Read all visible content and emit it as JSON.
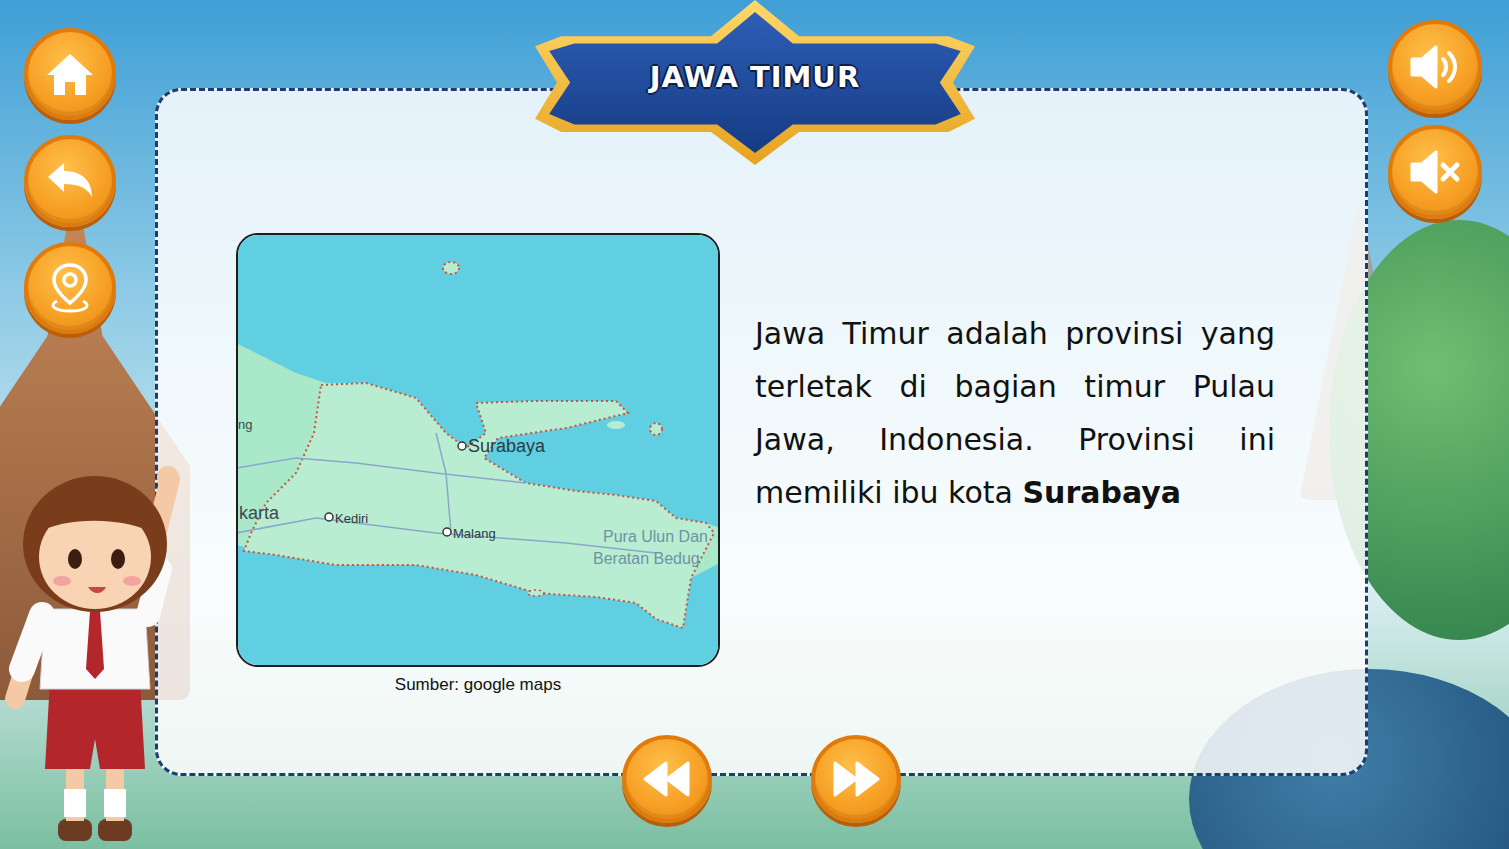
{
  "title": "JAWA TIMUR",
  "map": {
    "labels": [
      {
        "text": "Surabaya",
        "kind": "city"
      },
      {
        "text": "Kediri",
        "kind": "city"
      },
      {
        "text": "Malang",
        "kind": "city"
      },
      {
        "text": "ng",
        "kind": "edge"
      },
      {
        "text": "karta",
        "kind": "edge"
      },
      {
        "text": "Pura Ulun Dan",
        "kind": "poi"
      },
      {
        "text": "Beratan Bedug",
        "kind": "poi"
      }
    ],
    "caption": "Sumber: google maps"
  },
  "description": {
    "text": "Jawa Timur adalah provinsi yang terletak di bagian timur Pulau Jawa, Indonesia. Provinsi ini memiliki ibu kota ",
    "highlight": "Surabaya"
  }
}
